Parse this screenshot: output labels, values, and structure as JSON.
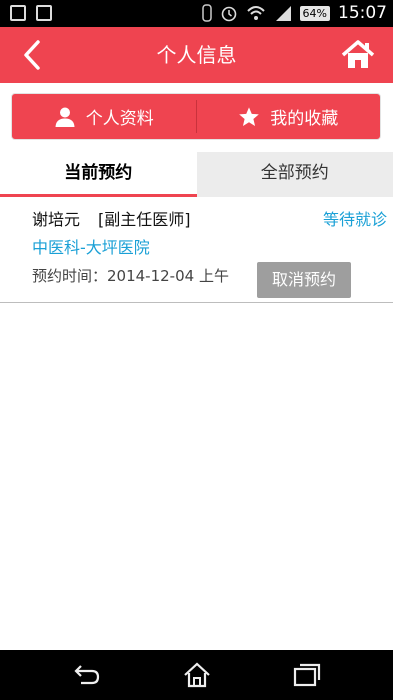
{
  "status_bar": {
    "battery": "64%",
    "time": "15:07"
  },
  "header": {
    "title": "个人信息",
    "back_icon": "chevron-left-icon",
    "home_icon": "home-icon"
  },
  "segment": {
    "profile_label": "个人资料",
    "favorites_label": "我的收藏"
  },
  "tabs": [
    {
      "label": "当前预约",
      "active": true
    },
    {
      "label": "全部预约",
      "active": false
    }
  ],
  "appointment": {
    "doctor": "谢培元",
    "title": "[副主任医师]",
    "status": "等待就诊",
    "hospital": "中医科-大坪医院",
    "time_label": "预约时间：2014-12-04 上午",
    "cancel_label": "取消预约"
  },
  "colors": {
    "accent": "#ef4450",
    "link": "#1aa0d6",
    "button_gray": "#9e9e9e"
  }
}
